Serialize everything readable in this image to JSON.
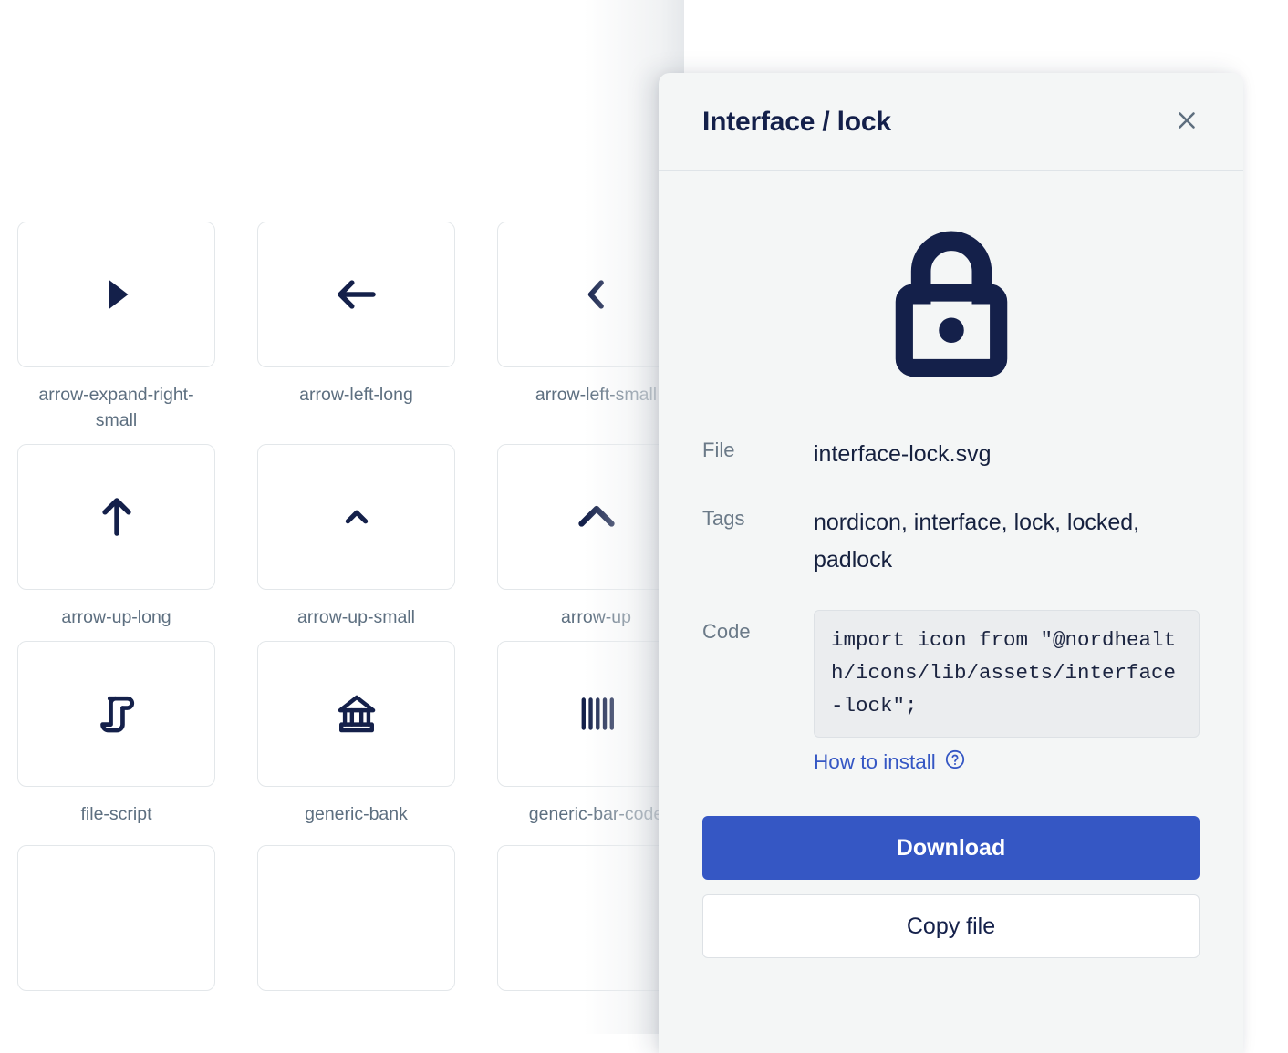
{
  "grid": {
    "rows": [
      [
        {
          "icon": "arrow-expand-right-small-icon",
          "label": "arrow-expand-right-small"
        },
        {
          "icon": "arrow-left-long-icon",
          "label": "arrow-left-long"
        },
        {
          "icon": "arrow-left-small-icon",
          "label": "arrow-left-small"
        }
      ],
      [
        {
          "icon": "arrow-up-long-icon",
          "label": "arrow-up-long"
        },
        {
          "icon": "arrow-up-small-icon",
          "label": "arrow-up-small"
        },
        {
          "icon": "arrow-up-icon",
          "label": "arrow-up"
        }
      ],
      [
        {
          "icon": "file-script-icon",
          "label": "file-script"
        },
        {
          "icon": "generic-bank-icon",
          "label": "generic-bank"
        },
        {
          "icon": "generic-bar-code-icon",
          "label": "generic-bar-code"
        }
      ]
    ]
  },
  "panel": {
    "title": "Interface / lock",
    "close_label": "Close",
    "preview_icon": "lock-icon",
    "fields": {
      "file_label": "File",
      "file_value": "interface-lock.svg",
      "tags_label": "Tags",
      "tags_value": "nordicon, interface, lock, locked, padlock",
      "code_label": "Code",
      "code_value": "import icon from \"@nordhealth/icons/lib/assets/interface-lock\";",
      "install_link": "How to install"
    },
    "buttons": {
      "download": "Download",
      "copy": "Copy file"
    }
  },
  "colors": {
    "icon_navy": "#14204a",
    "accent_blue": "#3557c4",
    "panel_bg": "#f4f6f6",
    "label_grey": "#5d6f80",
    "code_bg": "#ebedef"
  }
}
